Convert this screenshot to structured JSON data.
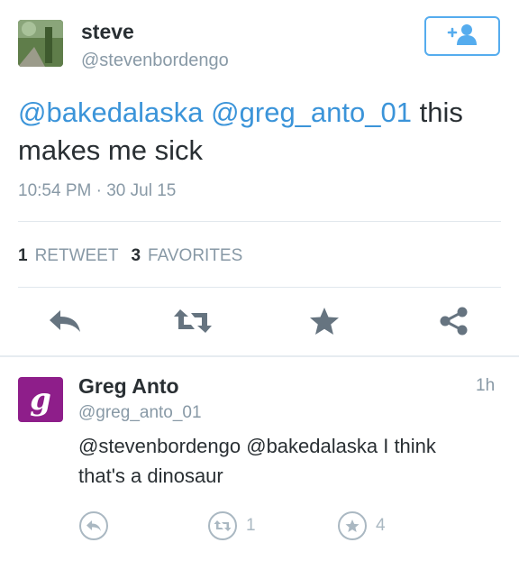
{
  "tweet": {
    "name": "steve",
    "handle": "@stevenbordengo",
    "mention_1": "@bakedalaska",
    "mention_2": "@greg_anto_01",
    "text_tail_1": " this",
    "text_tail_2": "makes me sick",
    "timestamp": "10:54 PM · 30 Jul 15"
  },
  "stats": {
    "retweets_count": "1",
    "retweets_label": "RETWEET",
    "favorites_count": "3",
    "favorites_label": "FAVORITES"
  },
  "actions": [
    "reply-icon",
    "retweet-icon",
    "favorite-star-icon",
    "share-icon"
  ],
  "reply": {
    "avatar_glyph": "g",
    "name": "Greg Anto",
    "handle": "@greg_anto_01",
    "time": "1h",
    "text_line_1": "@stevenbordengo @bakedalaska I think",
    "text_line_2": "that's a dinosaur",
    "retweet_count": "1",
    "favorite_count": "4"
  },
  "colors": {
    "link": "#3b94d9",
    "accent": "#55acee",
    "muted": "#8899a6",
    "reply_avatar": "#8e1e8a"
  }
}
